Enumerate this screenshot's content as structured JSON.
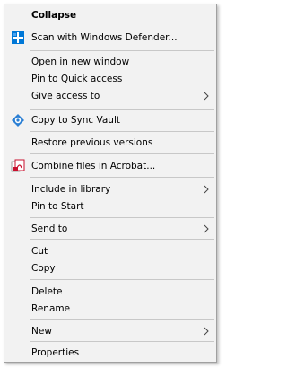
{
  "menu": {
    "collapse": "Collapse",
    "scan_defender": "Scan with Windows Defender...",
    "open_new_window": "Open in new window",
    "pin_quick_access": "Pin to Quick access",
    "give_access_to": "Give access to",
    "copy_sync_vault": "Copy to Sync Vault",
    "restore_previous": "Restore previous versions",
    "combine_acrobat": "Combine files in Acrobat...",
    "include_library": "Include in library",
    "pin_start": "Pin to Start",
    "send_to": "Send to",
    "cut": "Cut",
    "copy": "Copy",
    "delete": "Delete",
    "rename": "Rename",
    "new": "New",
    "properties": "Properties"
  },
  "icons": {
    "defender": "windows-defender-icon",
    "sync_vault": "sync-vault-icon",
    "acrobat": "acrobat-combine-icon",
    "submenu": "chevron-right-icon"
  },
  "colors": {
    "menu_bg": "#f2f2f2",
    "border": "#a0a0a0",
    "separator": "#c8c8c8",
    "defender_blue": "#0078d7",
    "acrobat_red": "#c8102e"
  }
}
